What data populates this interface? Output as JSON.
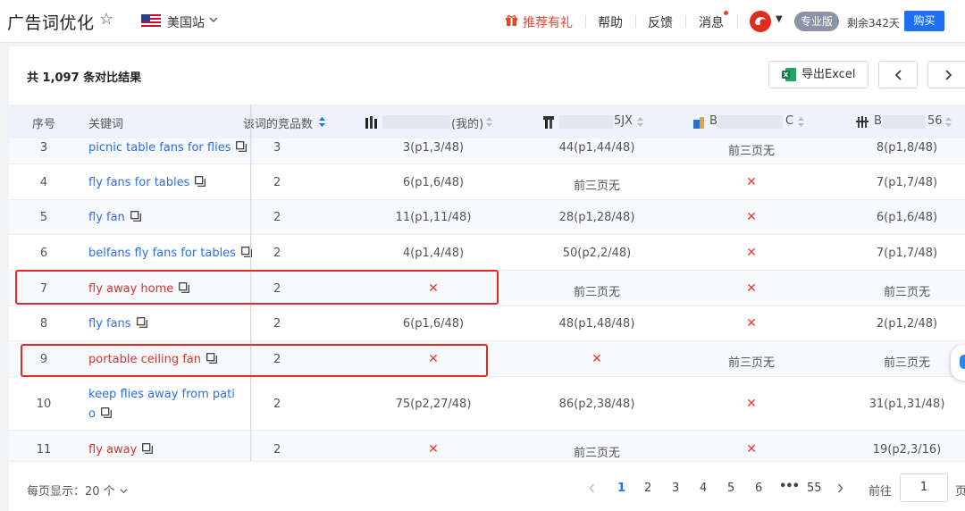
{
  "header": {
    "title": "广告词优化",
    "site": "美国站",
    "promo": "推荐有礼",
    "nav": [
      "帮助",
      "反馈",
      "消息"
    ],
    "plan": "专业版",
    "days_left": "剩余342天",
    "buy": "购买"
  },
  "toolbar": {
    "result_count": "共 1,097 条对比结果",
    "export": "导出Excel"
  },
  "table": {
    "columns": {
      "index": "序号",
      "keyword": "关键词",
      "competitor_count": "该词的竞品数",
      "product_a": "(我的)",
      "product_b": "5JX",
      "product_c": "B",
      "product_c_suffix": "C",
      "product_d": "B",
      "product_d_suffix": "56"
    },
    "rows": [
      {
        "idx": "3",
        "kw": "picnic table fans for flies",
        "cnt": "3",
        "a": "3(p1,3/48)",
        "b": "44(p1,44/48)",
        "c": "前三页无",
        "d": "8(p1,8/48)"
      },
      {
        "idx": "4",
        "kw": "fly fans for tables",
        "cnt": "2",
        "a": "6(p1,6/48)",
        "b": "前三页无",
        "c": "✕",
        "d": "7(p1,7/48)"
      },
      {
        "idx": "5",
        "kw": "fly fan",
        "cnt": "2",
        "a": "11(p1,11/48)",
        "b": "28(p1,28/48)",
        "c": "✕",
        "d": "6(p1,6/48)"
      },
      {
        "idx": "6",
        "kw": "belfans fly fans for tables",
        "cnt": "2",
        "a": "4(p1,4/48)",
        "b": "50(p2,2/48)",
        "c": "✕",
        "d": "7(p1,7/48)"
      },
      {
        "idx": "7",
        "kw": "fly away home",
        "cnt": "2",
        "a": "✕",
        "b": "前三页无",
        "c": "✕",
        "d": "前三页无"
      },
      {
        "idx": "8",
        "kw": "fly fans",
        "cnt": "2",
        "a": "6(p1,6/48)",
        "b": "48(p1,48/48)",
        "c": "✕",
        "d": "2(p1,2/48)"
      },
      {
        "idx": "9",
        "kw": "portable ceiling fan",
        "cnt": "2",
        "a": "✕",
        "b": "✕",
        "c": "前三页无",
        "d": "前三页无"
      },
      {
        "idx": "10",
        "kw": "keep flies away from pati",
        "kw2": "o",
        "cnt": "2",
        "a": "75(p2,27/48)",
        "b": "86(p2,38/48)",
        "c": "✕",
        "d": "31(p1,31/48)"
      },
      {
        "idx": "11",
        "kw": "fly away",
        "cnt": "2",
        "a": "✕",
        "b": "前三页无",
        "c": "✕",
        "d": "19(p2,3/16)"
      }
    ]
  },
  "pagination": {
    "page_size": "每页显示：20 个",
    "pages": [
      "1",
      "2",
      "3",
      "4",
      "5",
      "6",
      "•••",
      "55"
    ],
    "goto_label": "前往",
    "goto_value": "1",
    "suffix": "页"
  },
  "colors": {
    "accent": "#1e6ff1",
    "link": "#2b6ef0",
    "highlight": "#e42a22",
    "cross": "#e03c31"
  }
}
